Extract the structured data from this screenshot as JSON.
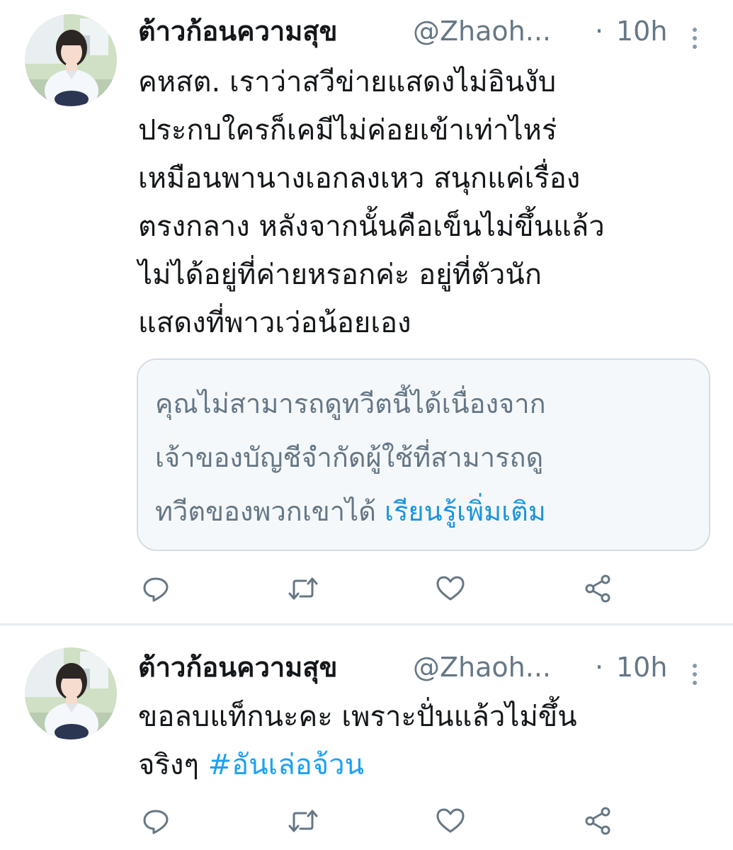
{
  "tweets": [
    {
      "display_name": "ต้าวก้อนความสุข",
      "handle": "@Zhaoh...",
      "separator": "·",
      "time": "10h",
      "body_lines": [
        "คหสต. เราว่าสวีข่ายแสดงไม่อินงับ",
        "ประกบใครก็เคมีไม่ค่อยเข้าเท่าไหร่",
        "เหมือนพานางเอกลงเหว สนุกแค่เรื่อง",
        "ตรงกลาง หลังจากนั้นคือเข็นไม่ขึ้นแล้ว",
        "ไม่ได้อยู่ที่ค่ายหรอกค่ะ อยู่ที่ตัวนัก",
        "แสดงที่พาวเว่อน้อยเอง"
      ],
      "notice": {
        "lines": [
          "คุณไม่สามารถดูทวีตนี้ได้เนื่องจาก",
          "เจ้าของบัญชีจำกัดผู้ใช้ที่สามารถดู",
          "ทวีตของพวกเขาได้"
        ],
        "link": "เรียนรู้เพิ่มเติม"
      }
    },
    {
      "display_name": "ต้าวก้อนความสุข",
      "handle": "@Zhaoh...",
      "separator": "·",
      "time": "10h",
      "body_lines": [
        "ขอลบแท็กนะคะ เพราะปั่นแล้วไม่ขึ้น",
        "จริงๆ"
      ],
      "hashtag": "#อันเล่อจ้วน"
    }
  ],
  "icons": {
    "reply": "reply-icon",
    "retweet": "retweet-icon",
    "like": "like-icon",
    "share": "share-icon",
    "more": "more-vertical-icon"
  },
  "colors": {
    "text": "#14171a",
    "secondary": "#657786",
    "link": "#1da1f2",
    "notice_bg": "#f5f8fa",
    "notice_border": "#d5dde3"
  }
}
